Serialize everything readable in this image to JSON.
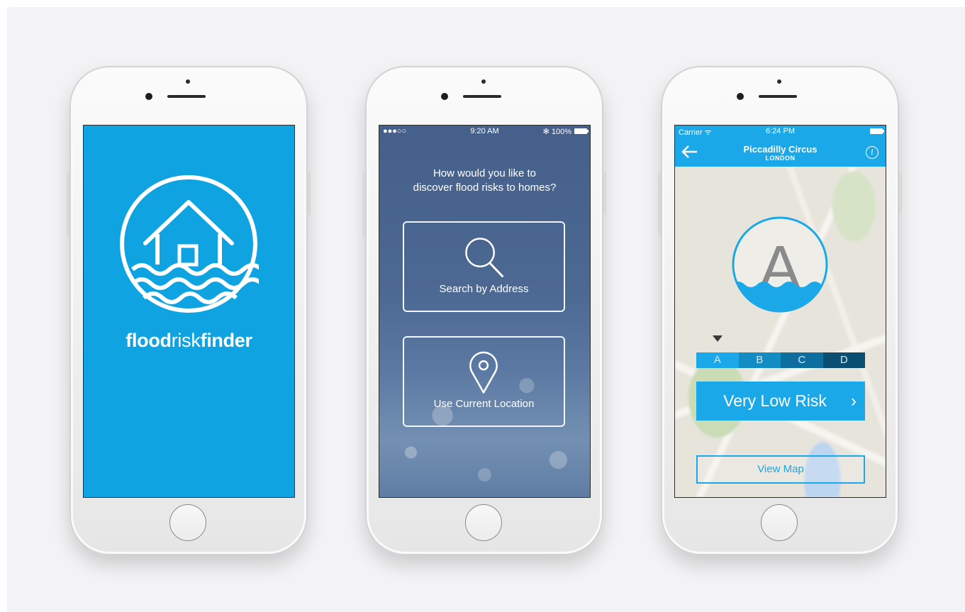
{
  "splash": {
    "brand_flood": "flood",
    "brand_risk": "risk",
    "brand_finder": "finder",
    "background": "#0fa4e1"
  },
  "choose_screen": {
    "status": {
      "signal": "●●●○○",
      "time": "9:20 AM",
      "battery": "✻ 100%"
    },
    "question_line1": "How would you like to",
    "question_line2": "discover flood risks to homes?",
    "options": [
      {
        "label": "Search by Address",
        "icon": "magnifier-icon"
      },
      {
        "label": "Use Current Location",
        "icon": "location-pin-icon"
      }
    ]
  },
  "result_screen": {
    "status": {
      "carrier": "Carrier ᯤ",
      "time": "6:24 PM"
    },
    "place": "Piccadilly Circus",
    "city": "LONDON",
    "rating": "A",
    "scale": [
      {
        "label": "A",
        "color": "#1aa8e8"
      },
      {
        "label": "B",
        "color": "#138cc4"
      },
      {
        "label": "C",
        "color": "#0e6f9e"
      },
      {
        "label": "D",
        "color": "#0a4f72"
      }
    ],
    "risk_label": "Very Low Risk",
    "risk_chevron": "›",
    "view_map_label": "View Map",
    "accent": "#1aa8e8"
  }
}
